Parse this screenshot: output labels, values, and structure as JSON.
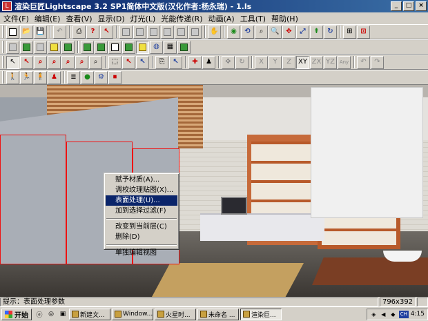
{
  "window": {
    "title": "渲染巨匠Lightscape 3.2 SP1简体中文版(汉化作者:杨永瑞) - 1.ls",
    "controls": [
      "_",
      "□",
      "×"
    ]
  },
  "menu": [
    "文件(F)",
    "编辑(E)",
    "查看(V)",
    "显示(D)",
    "灯光(L)",
    "光能传递(R)",
    "动画(A)",
    "工具(T)",
    "帮助(H)"
  ],
  "toolbar_axis": [
    "X",
    "Y",
    "Z",
    "XY",
    "ZX",
    "YZ",
    "Any"
  ],
  "context_menu": {
    "group1": [
      "赋予材质(A)...",
      "调校纹理贴图(X)...",
      "表面处理(U)...",
      "加到选择过滤(F)"
    ],
    "group2": [
      "改变到当前层(C)",
      "删除(D)"
    ],
    "group3": [
      "单独编辑视图"
    ],
    "selected_index": 2
  },
  "status": {
    "hint": "提示：表面处理参数",
    "dimensions": "796x392"
  },
  "taskbar": {
    "start": "开始",
    "tasks": [
      "新建文...",
      "Window...",
      "火星时...",
      "未命名 ...",
      "渲染巨..."
    ],
    "active_index": 4,
    "ime": "CH",
    "clock": "4:15"
  }
}
